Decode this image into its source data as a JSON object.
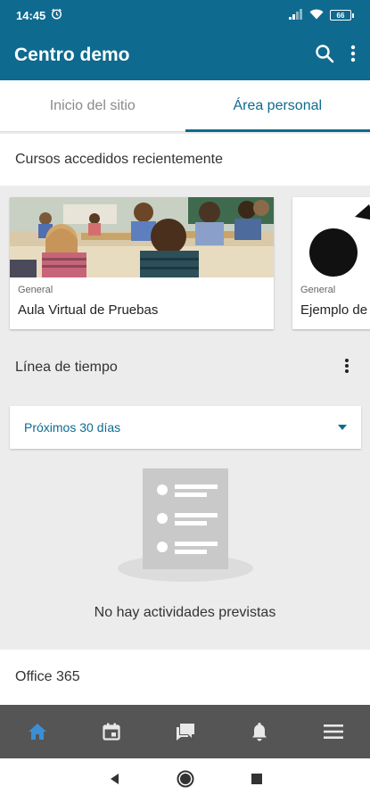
{
  "status": {
    "time": "14:45",
    "battery": "66"
  },
  "app": {
    "title": "Centro demo"
  },
  "tabs": [
    {
      "label": "Inicio del sitio",
      "active": false
    },
    {
      "label": "Área personal",
      "active": true
    }
  ],
  "recent": {
    "title": "Cursos accedidos recientemente",
    "courses": [
      {
        "category": "General",
        "name": "Aula Virtual de Pruebas"
      },
      {
        "category": "General",
        "name": "Ejemplo de"
      }
    ]
  },
  "timeline": {
    "title": "Línea de tiempo",
    "filter": "Próximos 30 días",
    "empty_message": "No hay actividades previstas"
  },
  "office": {
    "title": "Office 365"
  },
  "bottom_nav": [
    {
      "icon": "home-icon",
      "active": true
    },
    {
      "icon": "calendar-icon",
      "active": false
    },
    {
      "icon": "messages-icon",
      "active": false
    },
    {
      "icon": "bell-icon",
      "active": false
    },
    {
      "icon": "menu-icon",
      "active": false
    }
  ],
  "colors": {
    "primary": "#0f6a8f",
    "nav_active": "#3a8fd6",
    "nav_bg": "#555555"
  }
}
